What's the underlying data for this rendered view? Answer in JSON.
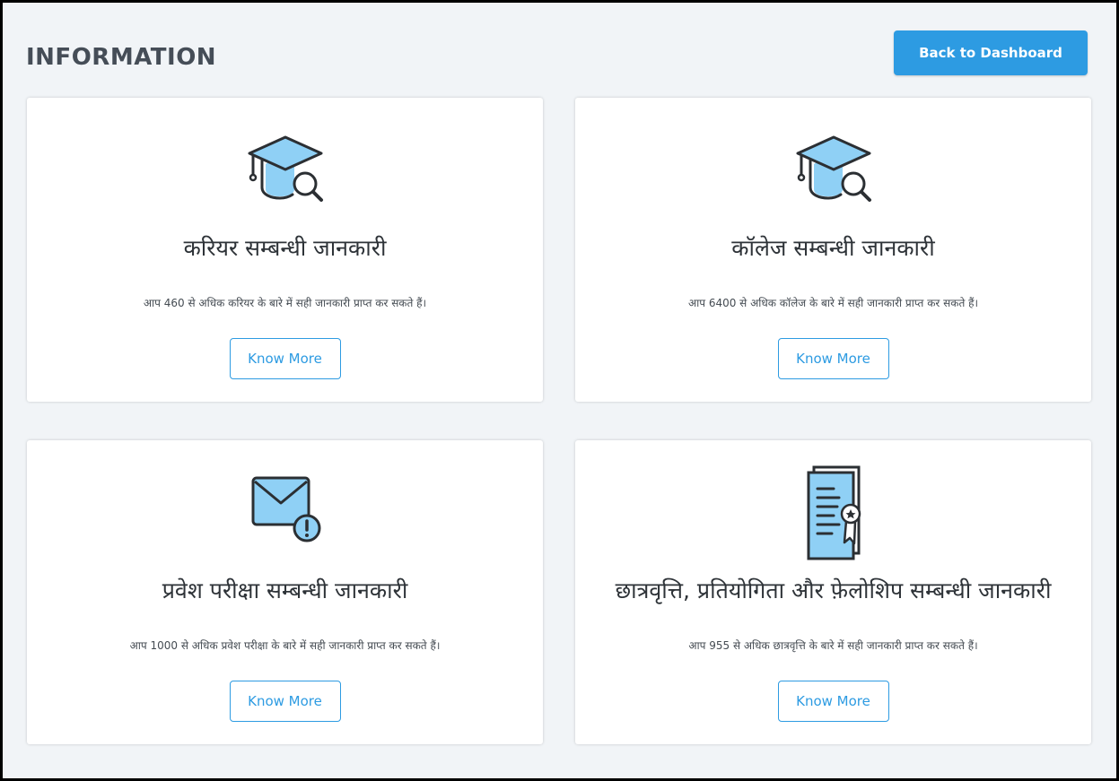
{
  "header": {
    "title": "INFORMATION",
    "back_button": "Back to Dashboard"
  },
  "colors": {
    "accent": "#2d9be2",
    "icon_fill": "#8fd0f5",
    "background": "#f1f4f7"
  },
  "cards": [
    {
      "icon": "graduation-cap-search-icon",
      "title": "करियर सम्बन्धी जानकारी",
      "description": "आप 460 से अधिक करियर के बारे में सही जानकारी प्राप्त कर सकते हैं।",
      "button": "Know More"
    },
    {
      "icon": "graduation-cap-search-icon",
      "title": "कॉलेज सम्बन्धी जानकारी",
      "description": "आप 6400 से अधिक कॉलेज के बारे में सही जानकारी प्राप्त कर सकते हैं।",
      "button": "Know More"
    },
    {
      "icon": "mail-alert-icon",
      "title": "प्रवेश परीक्षा सम्बन्धी जानकारी",
      "description": "आप 1000 से अधिक प्रवेश परीक्षा के बारे में सही जानकारी प्राप्त कर सकते हैं।",
      "button": "Know More"
    },
    {
      "icon": "certificate-icon",
      "title": "छात्रवृत्ति, प्रतियोगिता और फ़ेलोशिप सम्बन्धी जानकारी",
      "description": "आप 955 से अधिक छात्रवृत्ति के बारे में सही जानकारी प्राप्त कर सकते हैं।",
      "button": "Know More"
    }
  ]
}
